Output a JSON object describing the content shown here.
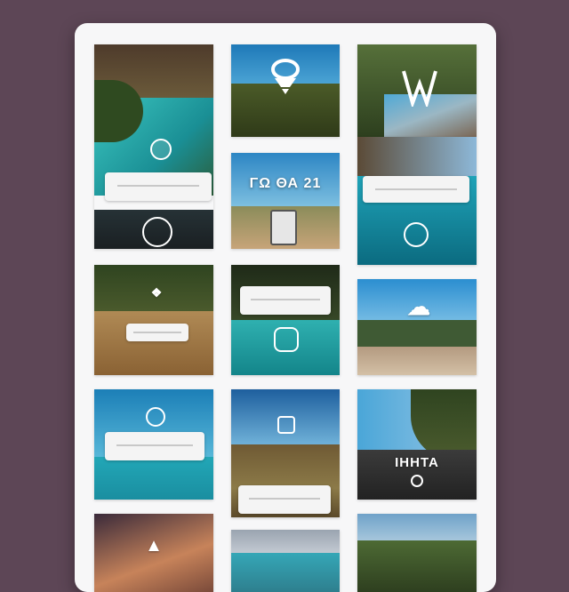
{
  "gallery": {
    "tiles": [
      {
        "scene": "pool-resort",
        "icon": "location-pin-icon"
      },
      {
        "scene": "hill-sky",
        "icon": "ice-cream-icon"
      },
      {
        "scene": "bridge-forest",
        "icon": "w-logo-icon"
      },
      {
        "scene": "road-vehicle",
        "icon": "",
        "caption": "ΓΩ ΘΑ 21"
      },
      {
        "scene": "lagoon-water",
        "icon": "circle-logo-icon"
      },
      {
        "scene": "dry-field",
        "icon": "badge-icon"
      },
      {
        "scene": "water-pool",
        "icon": "route-icon"
      },
      {
        "scene": "coast-road",
        "icon": "cloud-icon"
      },
      {
        "scene": "ocean",
        "icon": "circle-logo-icon"
      },
      {
        "scene": "valley-sky",
        "icon": "photo-icon"
      },
      {
        "scene": "highway-trees",
        "icon": "",
        "caption": "IHHTA"
      },
      {
        "scene": "rock-sunset",
        "icon": "monument-icon"
      },
      {
        "scene": "city-beach",
        "icon": ""
      },
      {
        "scene": "hills-green",
        "icon": ""
      }
    ]
  },
  "colors": {
    "page_background": "#5d4656",
    "panel_background": "#f7f7f8",
    "sky": "#2d8ec9",
    "water": "#1fa5a8",
    "earth": "#a47a4a",
    "foliage": "#3a4a22"
  }
}
